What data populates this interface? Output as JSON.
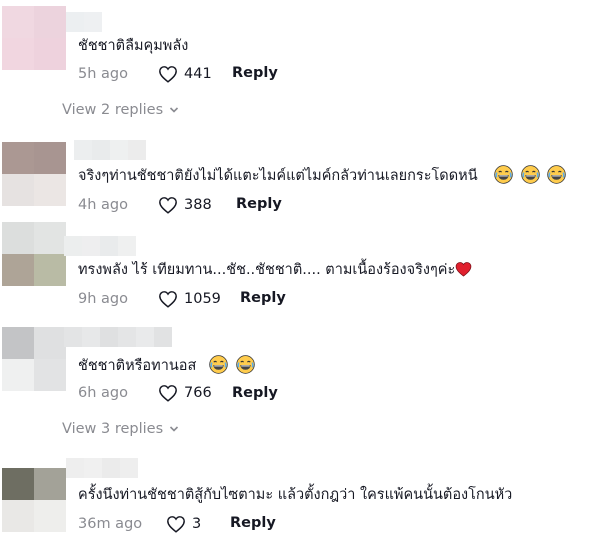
{
  "comments": [
    {
      "text": "ชัชชาติลืมคุมพลัง",
      "time": "5h ago",
      "likes": "441",
      "reply": "Reply",
      "trailing": ""
    },
    {
      "text": "จริงๆท่านชัชชาติยังไม่ได้แตะไมค์แต่ไมค์กลัวท่านเลยกระโดดหนี",
      "time": "4h ago",
      "likes": "388",
      "reply": "Reply",
      "trailing": "laughing-emoji x3"
    },
    {
      "text": "ทรงพลัง ไร้ เทียมทาน...ชัช..ชัชชาติ.... ตามเนื้องร้องจริงๆค่ะ",
      "time": "9h ago",
      "likes": "1059",
      "reply": "Reply",
      "trailing": "red-heart-emoji"
    },
    {
      "text": "ชัชชาติหรือทานอส",
      "time": "6h ago",
      "likes": "766",
      "reply": "Reply",
      "trailing": "laughing-emoji x2"
    },
    {
      "text": "ครั้งนึงท่านชัชชาติสู้กับไซตามะ แล้วตั้งกฎว่า ใครแพ้คนนั้นต้องโกนหัว",
      "time": "36m ago",
      "likes": "3",
      "reply": "Reply",
      "trailing": ""
    }
  ],
  "view_replies": [
    {
      "label": "View 2 replies"
    },
    {
      "label": "View 3 replies"
    }
  ],
  "icons": {
    "like": "heart-outline-icon",
    "chevron": "chevron-down-icon"
  },
  "colors": {
    "text": "#161823",
    "muted": "#8a8b91"
  }
}
